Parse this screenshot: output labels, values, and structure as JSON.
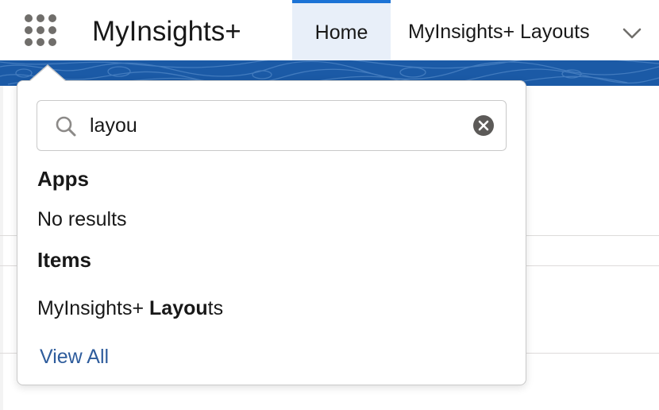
{
  "header": {
    "app_name": "MyInsights+",
    "launcher_icon": "waffle-grid-icon"
  },
  "tabs": [
    {
      "label": "Home",
      "active": true
    },
    {
      "label": "MyInsights+ Layouts",
      "active": false
    }
  ],
  "tab_overflow_icon": "chevron-down-icon",
  "colors": {
    "accent": "#1b73d6",
    "brand_band": "#1b5aa6",
    "active_tab_bg": "#e8eff9",
    "link": "#2e5c9c",
    "icon_gray": "#706e6b"
  },
  "search": {
    "value": "layou",
    "placeholder": "",
    "search_icon": "search-icon",
    "clear_icon": "clear-circle-icon"
  },
  "results": {
    "apps_heading": "Apps",
    "apps_empty": "No results",
    "items_heading": "Items",
    "items": [
      {
        "prefix": "MyInsights+ ",
        "match": "Layou",
        "suffix": "ts"
      }
    ],
    "view_all": "View All"
  }
}
